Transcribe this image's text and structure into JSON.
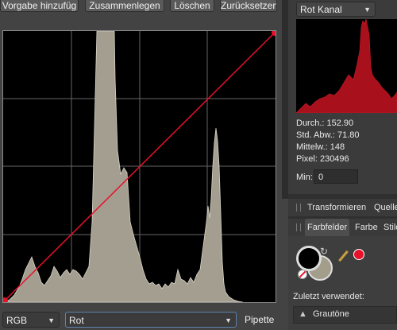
{
  "toolbar": {
    "add_preset": "Vorgabe hinzufüg",
    "merge": "Zusammenlegen",
    "delete": "Löschen",
    "reset": "Zurücksetzen"
  },
  "curve_editor": {
    "color_mode": "RGB",
    "channel": "Rot",
    "picker": "Pipette"
  },
  "histogram_panel": {
    "channel_select": "Rot Kanal",
    "stats": {
      "mean": "Durch.: 152.90",
      "std_dev": "Std. Abw.: 71.80",
      "median": "Mittelw.: 148",
      "pixels": "Pixel: 230496"
    },
    "min_label": "Min:",
    "min_value": "0"
  },
  "panels": {
    "tab_transform": "Transformieren",
    "tab_sources": "Quelle",
    "tab_swatches": "Farbfelder",
    "tab_color": "Farbe",
    "tab_styles": "Stile",
    "recently_used": "Zuletzt verwendet:",
    "palette_name": "Grautöne"
  },
  "colors": {
    "accent": "#e8102a",
    "histogram_fill": "#a39e90",
    "red_histogram": "#a8101c",
    "swatch_primary": "#000000",
    "swatch_secondary": "#a39e8b"
  }
}
